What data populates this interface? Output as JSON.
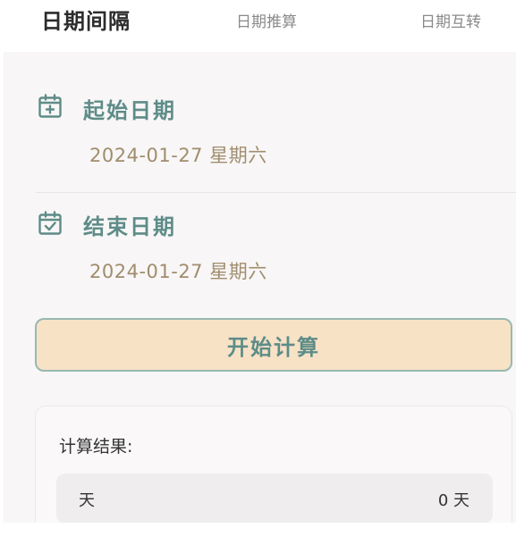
{
  "tabs": [
    {
      "label": "日期间隔",
      "active": true
    },
    {
      "label": "日期推算",
      "active": false
    },
    {
      "label": "日期互转",
      "active": false
    }
  ],
  "start": {
    "label": "起始日期",
    "value": "2024-01-27 星期六",
    "icon": "calendar-add-icon"
  },
  "end": {
    "label": "结束日期",
    "value": "2024-01-27 星期六",
    "icon": "calendar-check-icon"
  },
  "calc_button": {
    "label": "开始计算"
  },
  "result": {
    "title": "计算结果:",
    "rows": [
      {
        "key": "天",
        "value": "0 天"
      }
    ]
  },
  "colors": {
    "accent": "#5e8c88",
    "date_text": "#a08d6e",
    "button_bg": "#f7e2c6"
  }
}
